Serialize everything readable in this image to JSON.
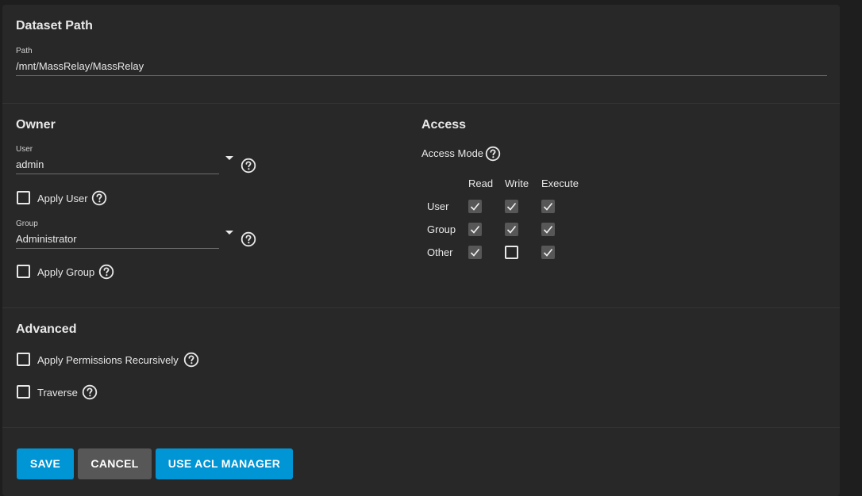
{
  "dataset": {
    "title": "Dataset Path",
    "path_label": "Path",
    "path_value": "/mnt/MassRelay/MassRelay"
  },
  "owner": {
    "title": "Owner",
    "user_label": "User",
    "user_value": "admin",
    "apply_user_label": "Apply User",
    "apply_user_checked": false,
    "group_label": "Group",
    "group_value": "Administrator",
    "apply_group_label": "Apply Group",
    "apply_group_checked": false
  },
  "access": {
    "title": "Access",
    "mode_label": "Access Mode",
    "columns": [
      "Read",
      "Write",
      "Execute"
    ],
    "rows": [
      {
        "label": "User",
        "read": true,
        "write": true,
        "execute": true
      },
      {
        "label": "Group",
        "read": true,
        "write": true,
        "execute": true
      },
      {
        "label": "Other",
        "read": true,
        "write": false,
        "execute": true
      }
    ]
  },
  "advanced": {
    "title": "Advanced",
    "recursive_label": "Apply Permissions Recursively",
    "recursive_checked": false,
    "traverse_label": "Traverse",
    "traverse_checked": false
  },
  "actions": {
    "save": "SAVE",
    "cancel": "CANCEL",
    "acl_manager": "USE ACL MANAGER"
  },
  "icons": {
    "help": "help-circle-icon",
    "dropdown": "caret-down-icon",
    "check": "check-icon"
  },
  "colors": {
    "primary": "#0095d5",
    "secondary": "#575757",
    "background": "#282828"
  }
}
